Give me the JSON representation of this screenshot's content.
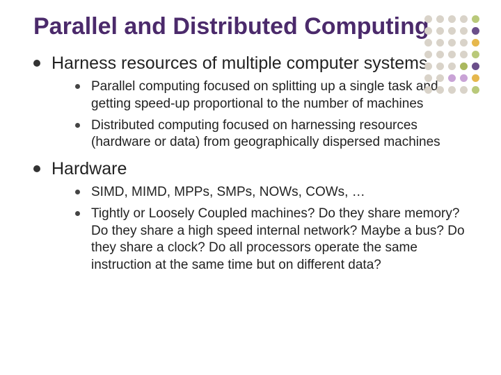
{
  "title": "Parallel and Distributed Computing",
  "sections": [
    {
      "heading": "Harness resources of multiple computer systems",
      "items": [
        "Parallel computing focused on splitting up a single task and getting speed-up proportional to the number of machines",
        "Distributed computing focused on harnessing resources (hardware or data) from geographically dispersed machines"
      ]
    },
    {
      "heading": "Hardware",
      "items": [
        "SIMD, MIMD, MPPs, SMPs, NOWs, COWs, …",
        "Tightly or Loosely Coupled machines? Do they share memory? Do they share a high speed internal network? Maybe a bus? Do they share a clock? Do all processors operate the same instruction at the same time but on different data?"
      ]
    }
  ],
  "deco_colors": {
    "base_rows": [
      "#d9d3c9",
      "#d9d3c9",
      "#d9d3c9",
      "#d9d3c9",
      "#d9d3c9",
      "#d9d3c9",
      "#d9d3c9"
    ],
    "accents": {
      "r0c4": "#b9c97a",
      "r1c4": "#6b4f8a",
      "r2c4": "#e6b84d",
      "r3c4": "#b9c97a",
      "r4c4": "#6b4f8a",
      "r5c4": "#e6b84d",
      "r6c4": "#b9c97a",
      "r4c3": "#aab85e",
      "r5c3": "#c9a3d6",
      "r5c2": "#c9a3d6"
    }
  }
}
